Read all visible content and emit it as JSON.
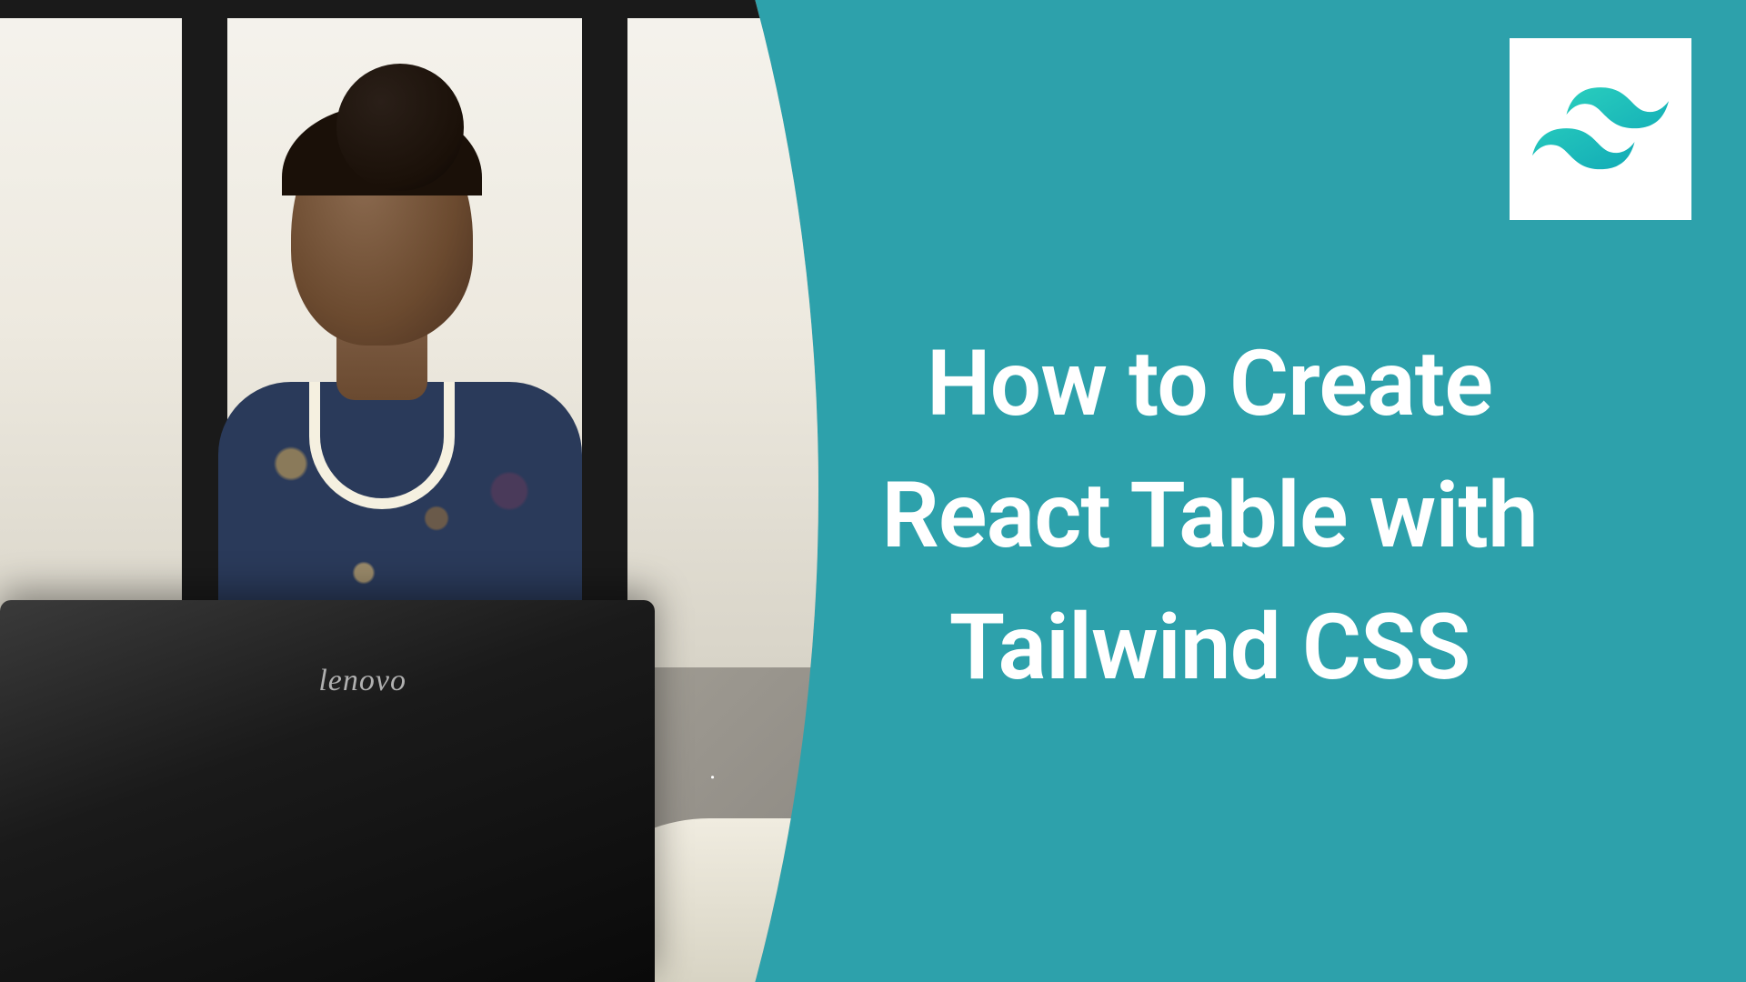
{
  "title_line1": "How to Create",
  "title_line2": "React Table with",
  "title_line3": "Tailwind CSS",
  "laptop_brand": "lenovo",
  "dot": ".",
  "colors": {
    "teal": "#2da1ab",
    "white": "#ffffff"
  },
  "logo": {
    "name": "tailwind-css"
  }
}
